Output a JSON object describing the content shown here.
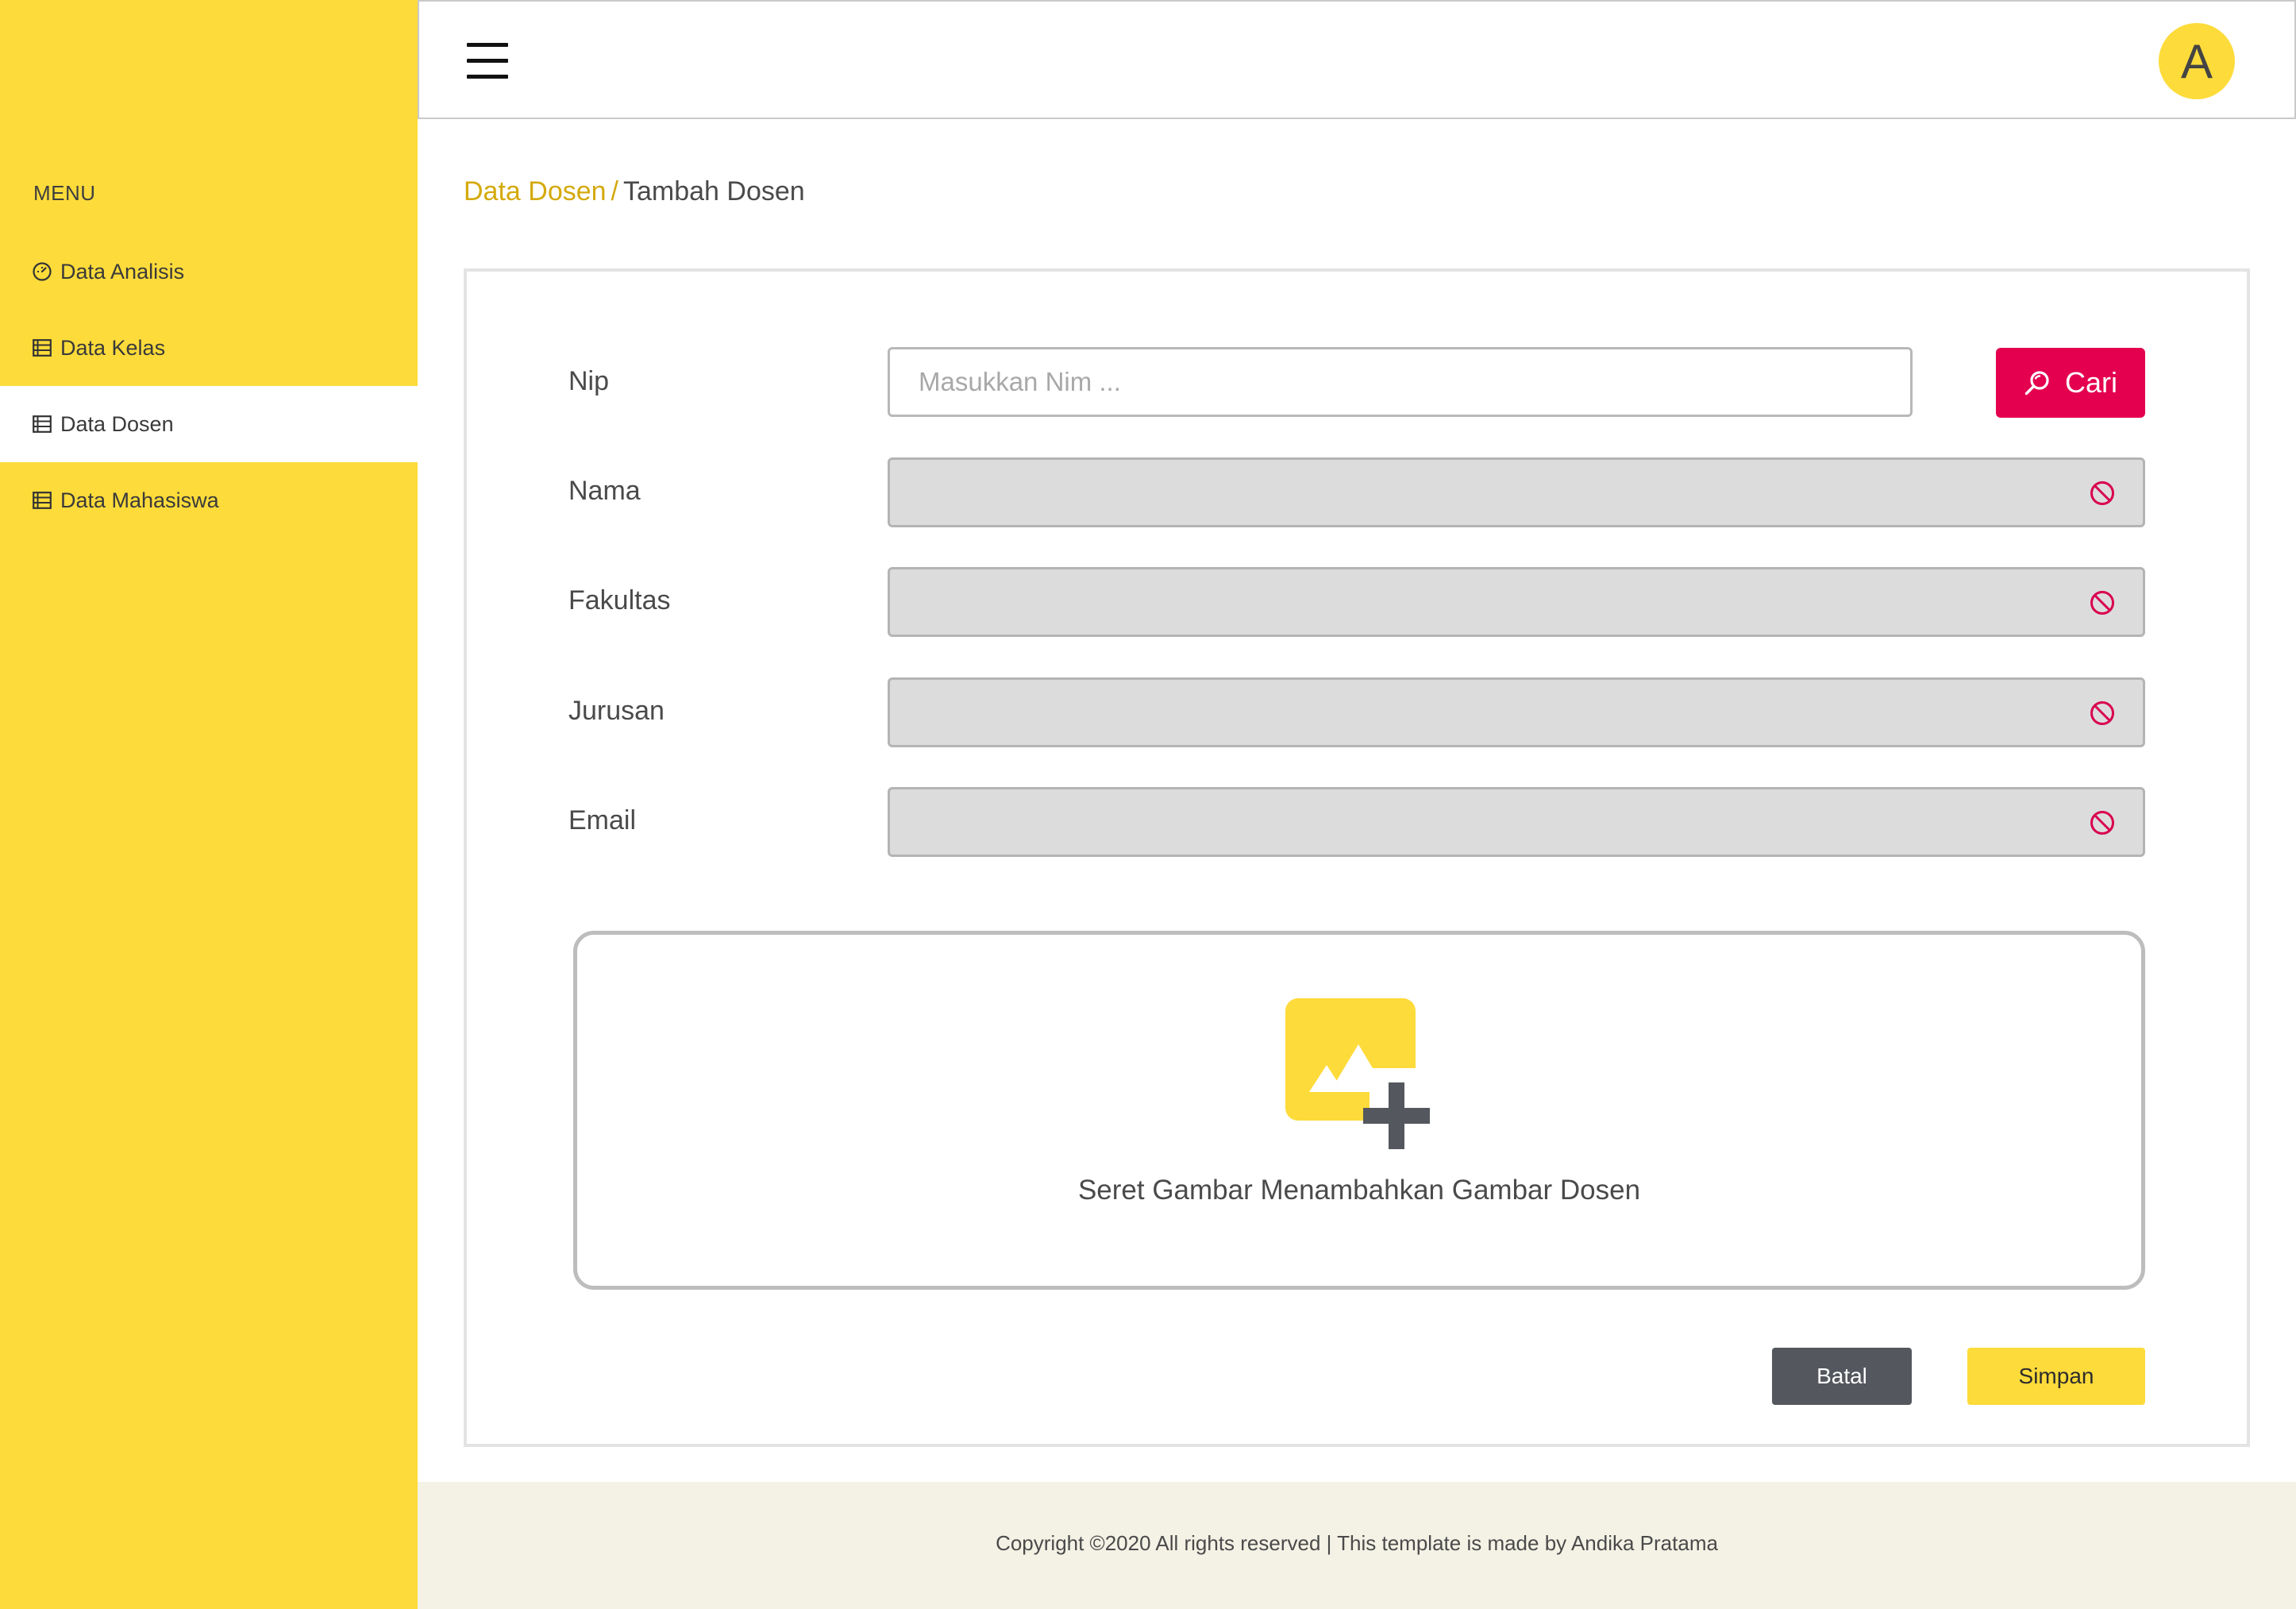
{
  "sidebar": {
    "menu_title": "MENU",
    "items": [
      {
        "label": "Data Analisis",
        "icon": "dashboard-icon",
        "active": false
      },
      {
        "label": "Data Kelas",
        "icon": "list-icon",
        "active": false
      },
      {
        "label": "Data Dosen",
        "icon": "list-icon",
        "active": true
      },
      {
        "label": "Data Mahasiswa",
        "icon": "list-icon",
        "active": false
      }
    ]
  },
  "header": {
    "avatar_letter": "A"
  },
  "breadcrumb": {
    "parent": "Data Dosen",
    "separator": "/",
    "current": "Tambah Dosen"
  },
  "form": {
    "nip": {
      "label": "Nip",
      "placeholder": "Masukkan Nim ...",
      "value": ""
    },
    "search_button": "Cari",
    "fields": [
      {
        "label": "Nama",
        "value": ""
      },
      {
        "label": "Fakultas",
        "value": ""
      },
      {
        "label": "Jurusan",
        "value": ""
      },
      {
        "label": "Email",
        "value": ""
      }
    ],
    "dropzone_text": "Seret Gambar Menambahkan Gambar Dosen",
    "cancel_button": "Batal",
    "save_button": "Simpan"
  },
  "footer": {
    "text": "Copyright ©2020 All rights reserved | This template is made by Andika Pratama"
  },
  "colors": {
    "primary_yellow": "#FDDB3A",
    "accent_red": "#E4004F",
    "dark_button": "#54575D",
    "breadcrumb_link": "#D4A90C",
    "footer_bg": "#F4F2E5"
  }
}
